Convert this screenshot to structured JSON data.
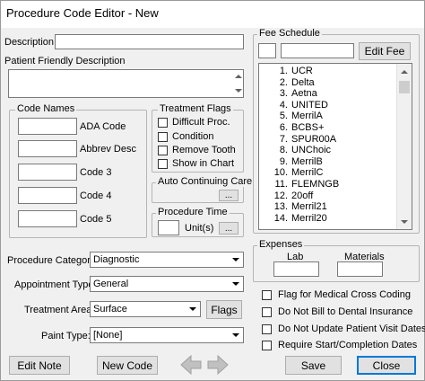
{
  "window": {
    "title": "Procedure Code Editor - New"
  },
  "description": {
    "label": "Description:",
    "value": ""
  },
  "patient_friendly": {
    "label": "Patient Friendly Description",
    "value": ""
  },
  "code_names": {
    "legend": "Code Names",
    "fields": [
      {
        "label": "ADA Code",
        "value": ""
      },
      {
        "label": "Abbrev Desc",
        "value": ""
      },
      {
        "label": "Code 3",
        "value": ""
      },
      {
        "label": "Code 4",
        "value": ""
      },
      {
        "label": "Code 5",
        "value": ""
      }
    ]
  },
  "treatment_flags": {
    "legend": "Treatment Flags",
    "items": [
      {
        "label": "Difficult Proc.",
        "checked": false
      },
      {
        "label": "Condition",
        "checked": false
      },
      {
        "label": "Remove Tooth",
        "checked": false
      },
      {
        "label": "Show in Chart",
        "checked": false
      }
    ]
  },
  "auto_continuing_care": {
    "legend": "Auto Continuing Care",
    "button_label": "..."
  },
  "procedure_time": {
    "legend": "Procedure Time",
    "unit_label": "Unit(s)",
    "value": "",
    "button_label": "..."
  },
  "fee_schedule": {
    "legend": "Fee Schedule",
    "edit_button": "Edit Fee",
    "small_value": "",
    "amount_value": "",
    "items": [
      {
        "num": "1.",
        "name": "UCR"
      },
      {
        "num": "2.",
        "name": "Delta"
      },
      {
        "num": "3.",
        "name": "Aetna"
      },
      {
        "num": "4.",
        "name": "UNITED"
      },
      {
        "num": "5.",
        "name": "MerrilA"
      },
      {
        "num": "6.",
        "name": "BCBS+"
      },
      {
        "num": "7.",
        "name": "SPUR00A"
      },
      {
        "num": "8.",
        "name": "UNChoic"
      },
      {
        "num": "9.",
        "name": "MerrilB"
      },
      {
        "num": "10.",
        "name": "MerrilC"
      },
      {
        "num": "11.",
        "name": "FLEMNGB"
      },
      {
        "num": "12.",
        "name": "20off"
      },
      {
        "num": "13.",
        "name": "Merril21"
      },
      {
        "num": "14.",
        "name": "Merril20"
      }
    ]
  },
  "expenses": {
    "legend": "Expenses",
    "lab_label": "Lab",
    "materials_label": "Materials",
    "lab_value": "",
    "materials_value": ""
  },
  "procedure_category": {
    "label": "Procedure Category:",
    "value": "Diagnostic"
  },
  "appointment_type": {
    "label": "Appointment Type:",
    "value": "General"
  },
  "treatment_area": {
    "label": "Treatment Area:",
    "value": "Surface",
    "flags_button": "Flags"
  },
  "paint_type": {
    "label": "Paint Type:",
    "value": "[None]"
  },
  "options": [
    {
      "label": "Flag for Medical Cross Coding",
      "checked": false
    },
    {
      "label": "Do Not Bill to Dental Insurance",
      "checked": false
    },
    {
      "label": "Do Not Update Patient Visit Dates",
      "checked": false
    },
    {
      "label": "Require Start/Completion Dates",
      "checked": false
    }
  ],
  "buttons": {
    "edit_note": "Edit Note",
    "new_code": "New Code",
    "save": "Save",
    "close": "Close"
  },
  "icons": {
    "prev": "left-arrow-icon",
    "next": "right-arrow-icon"
  }
}
